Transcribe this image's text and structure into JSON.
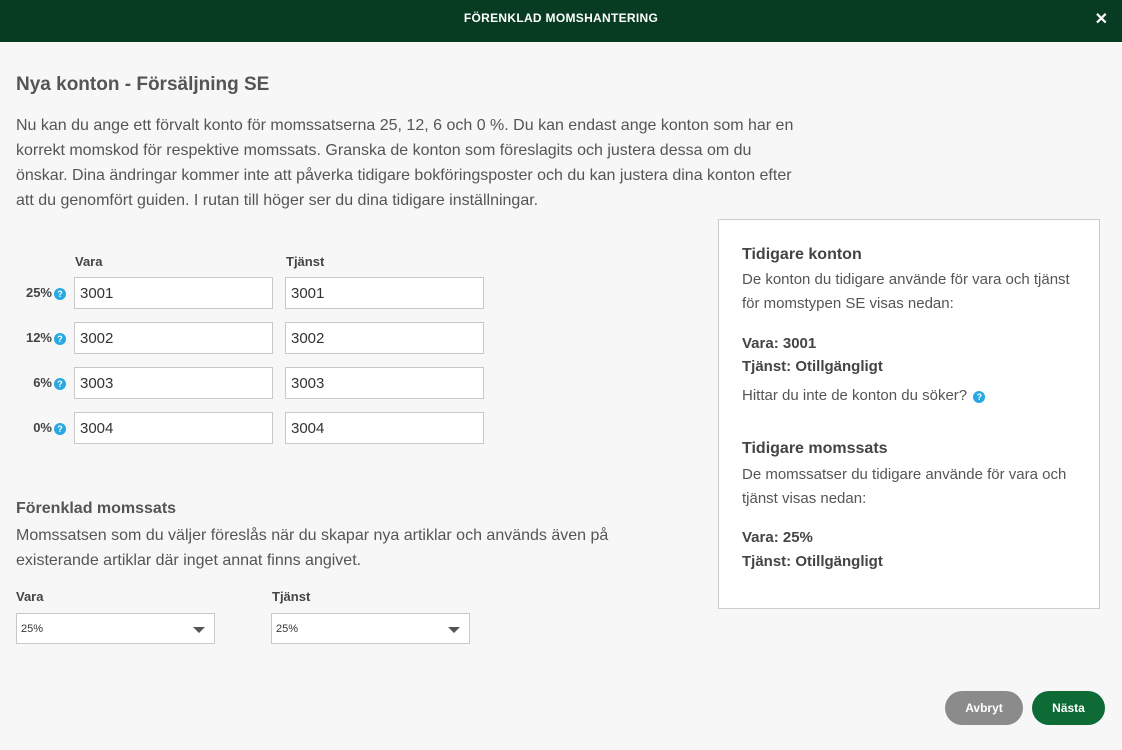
{
  "dialog": {
    "title": "FÖRENKLAD MOMSHANTERING"
  },
  "page": {
    "title": "Nya konton - Försäljning SE",
    "intro": "Nu kan du ange ett förvalt konto för momssatserna 25, 12, 6 och 0 %. Du kan endast ange konton som har en korrekt momskod för respektive momssats. Granska de konton som föreslagits och justera dessa om du önskar. Dina ändringar kommer inte att påverka tidigare bokföringsposter och du kan justera dina konton efter att du genomfört guiden. I rutan till höger ser du dina tidigare inställningar."
  },
  "accounts": {
    "col_vara": "Vara",
    "col_tjanst": "Tjänst",
    "help_glyph": "?",
    "rows": [
      {
        "rate": "25%",
        "vara": "3001",
        "tjanst": "3001"
      },
      {
        "rate": "12%",
        "vara": "3002",
        "tjanst": "3002"
      },
      {
        "rate": "6%",
        "vara": "3003",
        "tjanst": "3003"
      },
      {
        "rate": "0%",
        "vara": "3004",
        "tjanst": "3004"
      }
    ]
  },
  "moms": {
    "title": "Förenklad momssats",
    "description": "Momssatsen som du väljer föreslås när du skapar nya artiklar och används även på existerande artiklar där inget annat finns angivet.",
    "vara_label": "Vara",
    "vara_value": "25%",
    "tjanst_label": "Tjänst",
    "tjanst_value": "25%"
  },
  "sidebar": {
    "prev_accounts_title": "Tidigare konton",
    "prev_accounts_text": "De konton du tidigare använde för vara och tjänst för momstypen SE visas nedan:",
    "prev_vara": "Vara: 3001",
    "prev_tjanst": "Tjänst: Otillgängligt",
    "help_text": "Hittar du inte de konton du söker?",
    "prev_rate_title": "Tidigare momssats",
    "prev_rate_text": "De momssatser du tidigare använde för vara och tjänst visas nedan:",
    "prev_rate_vara": "Vara: 25%",
    "prev_rate_tjanst": "Tjänst: Otillgängligt"
  },
  "buttons": {
    "cancel": "Avbryt",
    "next": "Nästa"
  },
  "colors": {
    "header": "#073b22",
    "primary": "#0e6b36",
    "help": "#2aa8e0",
    "cancel": "#8b8b8b"
  },
  "icons": {
    "close": "close-icon",
    "help": "help-circle-icon",
    "dropdown": "chevron-down-icon"
  }
}
